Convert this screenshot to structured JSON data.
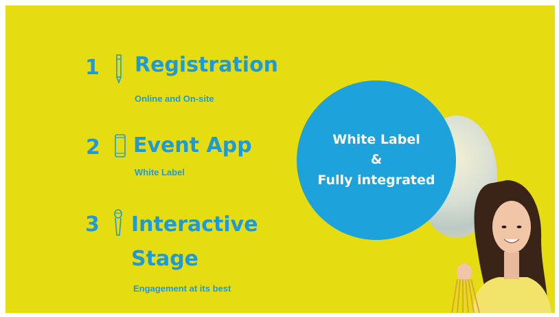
{
  "items": [
    {
      "number": "1",
      "title": "Registration",
      "subtitle": "Online and On-site",
      "icon": "pencil-icon"
    },
    {
      "number": "2",
      "title": "Event App",
      "subtitle": "White Label",
      "icon": "smartphone-icon"
    },
    {
      "number": "3",
      "title_line1": "Interactive",
      "title_line2": "Stage",
      "subtitle": "Engagement at its best",
      "icon": "microphone-icon"
    }
  ],
  "circle": {
    "line1": "White Label",
    "line2": "&",
    "line3": "Fully integrated"
  },
  "colors": {
    "background": "#e6dc12",
    "accent": "#1e9bd7",
    "circle": "#1ea2dc"
  }
}
